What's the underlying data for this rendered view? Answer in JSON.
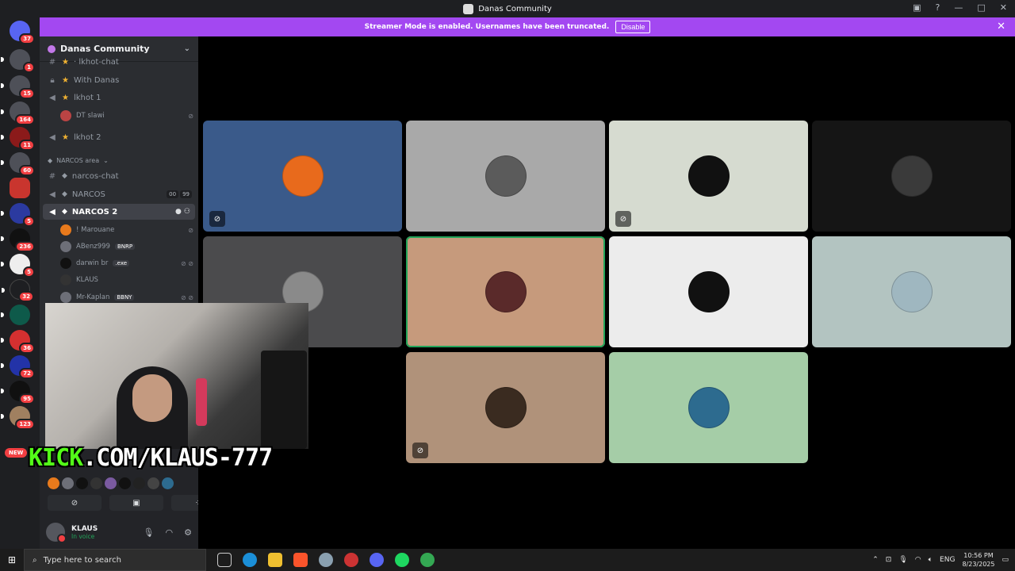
{
  "window": {
    "title": "Danas Community"
  },
  "banner": {
    "text": "Streamer Mode is enabled. Usernames have been truncated.",
    "disable_label": "Disable"
  },
  "rail": {
    "servers": [
      {
        "badge": "37"
      },
      {
        "badge": "1"
      },
      {
        "badge": "15"
      },
      {
        "badge": "164"
      },
      {
        "badge": "11"
      },
      {
        "badge": "60"
      },
      {
        "badge": ""
      },
      {
        "badge": "5"
      },
      {
        "badge": "236"
      },
      {
        "badge": "5"
      },
      {
        "badge": "32"
      },
      {
        "badge": ""
      },
      {
        "badge": "36"
      },
      {
        "badge": "72"
      },
      {
        "badge": "95"
      },
      {
        "badge": "123"
      }
    ],
    "new_label": "NEW"
  },
  "sidebar": {
    "guild_name": "Danas Community",
    "channels": [
      {
        "name": "· lkhot-chat",
        "icon": "#"
      },
      {
        "name": "With Danas",
        "icon": "lock"
      },
      {
        "name": "lkhot 1",
        "icon": "speaker"
      },
      {
        "name": "lkhot 2",
        "icon": "speaker"
      }
    ],
    "lkhot1_user": "DT slawi",
    "category": "NARCOS area",
    "narcos_channels": [
      {
        "name": "narcos-chat"
      },
      {
        "name": "NARCOS",
        "chip1": "00",
        "chip2": "99"
      },
      {
        "name": "NARCOS 2"
      }
    ],
    "voice_users": [
      {
        "name": "! Marouane",
        "tag": ""
      },
      {
        "name": "ABenz999",
        "tag": "BNRP"
      },
      {
        "name": "darwin br",
        "tag": ".exe"
      },
      {
        "name": "KLAUS",
        "tag": ""
      },
      {
        "name": "Mr-Kaplan",
        "tag": "BBNY"
      }
    ]
  },
  "user": {
    "name": "KLAUS",
    "status": "In voice"
  },
  "overlay": {
    "kick_prefix": "KICK",
    "kick_rest": ".COM/KLAUS-777"
  },
  "grid": {
    "tiles": [
      {
        "bg": "#3a5a8a",
        "avatar": "#e86a1c",
        "icon": "mute"
      },
      {
        "bg": "#a9a9a9",
        "avatar": "#5b5b5b",
        "icon": ""
      },
      {
        "bg": "#d6dbd0",
        "avatar": "#111111",
        "icon": "deafen"
      },
      {
        "bg": "#151515",
        "avatar": "#3a3a3a",
        "icon": ""
      },
      {
        "bg": "#4b4b4d",
        "avatar": "#8a8a8a",
        "icon": ""
      },
      {
        "bg": "#c69a7c",
        "avatar": "#5a2a2a",
        "icon": "",
        "speaking": true
      },
      {
        "bg": "#ececec",
        "avatar": "#111111",
        "icon": ""
      },
      {
        "bg": "#b3c4c1",
        "avatar": "#9fb7c0",
        "icon": ""
      },
      {
        "bg": "#b0927a",
        "avatar": "#3a2b20",
        "icon": "mute"
      },
      {
        "bg": "#a5cda7",
        "avatar": "#2d6b8f",
        "icon": ""
      }
    ]
  },
  "taskbar": {
    "search_placeholder": "Type here to search",
    "lang": "ENG",
    "time": "10:56 PM",
    "date": "8/23/2025"
  }
}
